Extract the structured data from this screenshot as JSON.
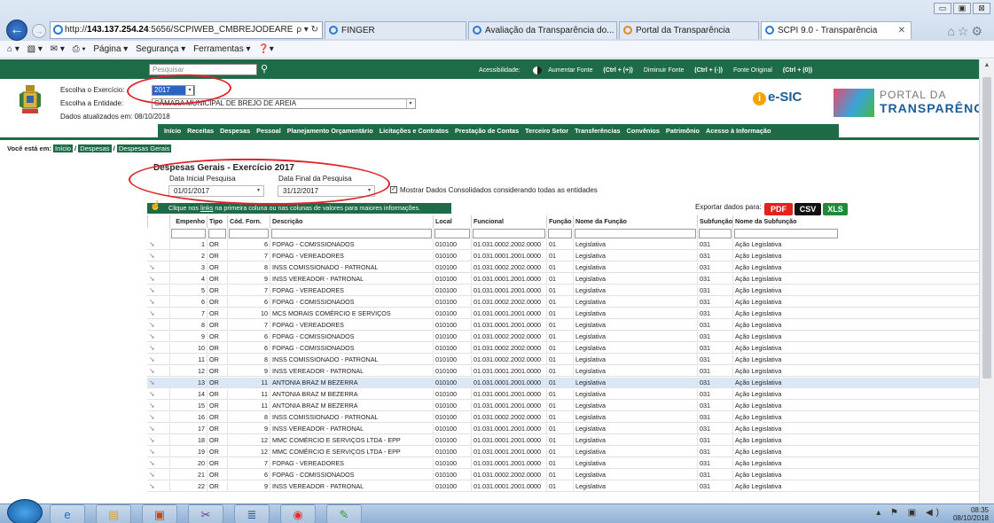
{
  "browser": {
    "url_prefix": "http://",
    "url_host": "143.137.254.24",
    "url_rest": ":5656/SCPIWEB_CMBREJODEARE",
    "url_controls": "ρ ▾ ↻",
    "tabs": [
      {
        "label": "FINGER"
      },
      {
        "label": "Avaliação da Transparência do..."
      },
      {
        "label": "Portal da Transparência"
      },
      {
        "label": "SCPI 9.0 - Transparência"
      }
    ],
    "toolbar": [
      "Página ▾",
      "Segurança ▾",
      "Ferramentas ▾"
    ],
    "window_controls": [
      "▭",
      "▣",
      "⊠"
    ],
    "fav_icons": "⌂☆⚙"
  },
  "header": {
    "search_placeholder": "Pesquisar",
    "accessibility_label": "Acessibilidade:",
    "font_increase": "Aumentar Fonte",
    "font_increase_key": "(Ctrl + (+))",
    "font_decrease": "Diminuir Fonte",
    "font_decrease_key": "(Ctrl + (-))",
    "font_original": "Fonte Original",
    "font_original_key": "(Ctrl + (0))",
    "exercise_label": "Escolha o Exercício:",
    "exercise_value": "2017",
    "entity_label": "Escolha a Entidade:",
    "entity_value": "CÂMARA MUNICIPAL DE BREJO DE AREIA",
    "updated": "Dados atualizados em: 08/10/2018",
    "esic": "e-SIC",
    "portal_line1": "PORTAL DA",
    "portal_line2": "TRANSPARÊNCIA"
  },
  "menu": [
    "Início",
    "Receitas",
    "Despesas",
    "Pessoal",
    "Planejamento Orçamentário",
    "Licitações e Contratos",
    "Prestação de Contas",
    "Terceiro Setor",
    "Transferências",
    "Convênios",
    "Patrimônio",
    "Acesso à Informação"
  ],
  "breadcrumb": {
    "prefix": "Você está em:",
    "items": [
      "Início",
      "Despesas",
      "Despesas Gerais"
    ],
    "sep": "/"
  },
  "page": {
    "title": "Despesas Gerais - Exercício 2017",
    "date_start_label": "Data Inicial Pesquisa",
    "date_start": "01/01/2017",
    "date_end_label": "Data Final da Pesquisa",
    "date_end": "31/12/2017",
    "consolidated_label": "Mostrar Dados Consolidados considerando todas as entidades",
    "consolidated_checked": true,
    "info_pre": "Clique nos",
    "info_link": "links",
    "info_post": "na primeira coluna ou nas colunas de valores para maiores informações.",
    "export_label": "Exportar dados para:",
    "export_buttons": [
      {
        "label": "PDF",
        "color": "#e2231a"
      },
      {
        "label": "CSV",
        "color": "#111111"
      },
      {
        "label": "XLS",
        "color": "#1f8b3a"
      }
    ]
  },
  "table": {
    "columns": [
      "",
      "Empenho",
      "Tipo",
      "Cód. Forn.",
      "Descrição",
      "Local",
      "Funcional",
      "Função",
      "Nome da Função",
      "Subfunção",
      "Nome da Subfunção"
    ],
    "rows": [
      [
        "1",
        "OR",
        "6",
        "FOPAG - COMISSIONADOS",
        "010100",
        "01.031.0002.2002.0000",
        "01",
        "Legislativa",
        "031",
        "Ação Legislativa"
      ],
      [
        "2",
        "OR",
        "7",
        "FOPAG - VEREADORES",
        "010100",
        "01.031.0001.2001.0000",
        "01",
        "Legislativa",
        "031",
        "Ação Legislativa"
      ],
      [
        "3",
        "OR",
        "8",
        "INSS COMISSIONADO - PATRONAL",
        "010100",
        "01.031.0002.2002.0000",
        "01",
        "Legislativa",
        "031",
        "Ação Legislativa"
      ],
      [
        "4",
        "OR",
        "9",
        "INSS VEREADOR - PATRONAL",
        "010100",
        "01.031.0001.2001.0000",
        "01",
        "Legislativa",
        "031",
        "Ação Legislativa"
      ],
      [
        "5",
        "OR",
        "7",
        "FOPAG - VEREADORES",
        "010100",
        "01.031.0001.2001.0000",
        "01",
        "Legislativa",
        "031",
        "Ação Legislativa"
      ],
      [
        "6",
        "OR",
        "6",
        "FOPAG - COMISSIONADOS",
        "010100",
        "01.031.0002.2002.0000",
        "01",
        "Legislativa",
        "031",
        "Ação Legislativa"
      ],
      [
        "7",
        "OR",
        "10",
        "MCS MORAIS COMÉRCIO E SERVIÇOS",
        "010100",
        "01.031.0001.2001.0000",
        "01",
        "Legislativa",
        "031",
        "Ação Legislativa"
      ],
      [
        "8",
        "OR",
        "7",
        "FOPAG - VEREADORES",
        "010100",
        "01.031.0001.2001.0000",
        "01",
        "Legislativa",
        "031",
        "Ação Legislativa"
      ],
      [
        "9",
        "OR",
        "6",
        "FOPAG - COMISSIONADOS",
        "010100",
        "01.031.0002.2002.0000",
        "01",
        "Legislativa",
        "031",
        "Ação Legislativa"
      ],
      [
        "10",
        "OR",
        "6",
        "FOPAG - COMISSIONADOS",
        "010100",
        "01.031.0002.2002.0000",
        "01",
        "Legislativa",
        "031",
        "Ação Legislativa"
      ],
      [
        "11",
        "OR",
        "8",
        "INSS COMISSIONADO - PATRONAL",
        "010100",
        "01.031.0002.2002.0000",
        "01",
        "Legislativa",
        "031",
        "Ação Legislativa"
      ],
      [
        "12",
        "OR",
        "9",
        "INSS VEREADOR - PATRONAL",
        "010100",
        "01.031.0001.2001.0000",
        "01",
        "Legislativa",
        "031",
        "Ação Legislativa"
      ],
      [
        "13",
        "OR",
        "11",
        "ANTONIA BRAZ M BEZERRA",
        "010100",
        "01.031.0001.2001.0000",
        "01",
        "Legislativa",
        "031",
        "Ação Legislativa"
      ],
      [
        "14",
        "OR",
        "11",
        "ANTONIA BRAZ M BEZERRA",
        "010100",
        "01.031.0001.2001.0000",
        "01",
        "Legislativa",
        "031",
        "Ação Legislativa"
      ],
      [
        "15",
        "OR",
        "11",
        "ANTONIA BRAZ M BEZERRA",
        "010100",
        "01.031.0001.2001.0000",
        "01",
        "Legislativa",
        "031",
        "Ação Legislativa"
      ],
      [
        "16",
        "OR",
        "8",
        "INSS COMISSIONADO - PATRONAL",
        "010100",
        "01.031.0002.2002.0000",
        "01",
        "Legislativa",
        "031",
        "Ação Legislativa"
      ],
      [
        "17",
        "OR",
        "9",
        "INSS VEREADOR - PATRONAL",
        "010100",
        "01.031.0001.2001.0000",
        "01",
        "Legislativa",
        "031",
        "Ação Legislativa"
      ],
      [
        "18",
        "OR",
        "12",
        "MMC COMÉRCIO E SERVIÇOS LTDA - EPP",
        "010100",
        "01.031.0001.2001.0000",
        "01",
        "Legislativa",
        "031",
        "Ação Legislativa"
      ],
      [
        "19",
        "OR",
        "12",
        "MMC COMÉRCIO E SERVIÇOS LTDA - EPP",
        "010100",
        "01.031.0001.2001.0000",
        "01",
        "Legislativa",
        "031",
        "Ação Legislativa"
      ],
      [
        "20",
        "OR",
        "7",
        "FOPAG - VEREADORES",
        "010100",
        "01.031.0001.2001.0000",
        "01",
        "Legislativa",
        "031",
        "Ação Legislativa"
      ],
      [
        "21",
        "OR",
        "6",
        "FOPAG - COMISSIONADOS",
        "010100",
        "01.031.0002.2002.0000",
        "01",
        "Legislativa",
        "031",
        "Ação Legislativa"
      ],
      [
        "22",
        "OR",
        "9",
        "INSS VEREADOR - PATRONAL",
        "010100",
        "01.031.0001.2001.0000",
        "01",
        "Legislativa",
        "031",
        "Ação Legislativa"
      ]
    ],
    "highlighted_row": "13"
  },
  "taskbar": {
    "time": "08:35",
    "date": "08/10/2018",
    "tray": "▴ ⚑ ▣ ◀)"
  },
  "colors": {
    "green": "#1e6b48",
    "annotation": "#e0222a"
  }
}
